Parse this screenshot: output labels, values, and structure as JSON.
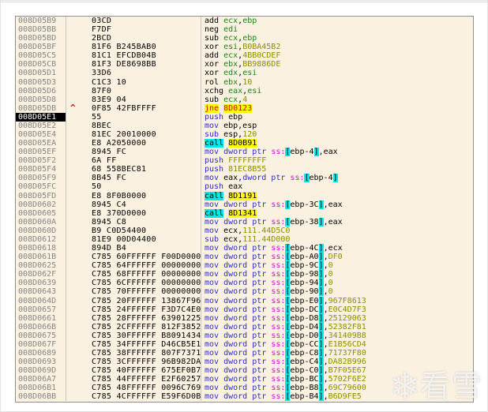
{
  "app": {
    "name": "debugger-disassembly-view"
  },
  "icons": {
    "jump_up": "^",
    "snowflake": "❄"
  },
  "watermark": {
    "text": "看雪"
  },
  "selected_address": "008D05E1",
  "colors": {
    "panel_background": "#FAF1E0",
    "address_gray": "#858585",
    "mnemonic_black": "#000000",
    "mnemonic_blue": "#2E2EC8",
    "register_green": "#178517",
    "number_olive": "#8D8D00",
    "segment_magenta": "#E400E4",
    "bracket_highlight": "#00E8E8",
    "call_highlight_bg": "#00E8E8",
    "target_highlight_bg": "#FFFF00",
    "jcc_red": "#CE0A0A",
    "selected_row_bg": "#000000",
    "selected_row_fg": "#FFFFFF"
  },
  "rows": [
    {
      "addr": "008D05B9",
      "bytes": "03CD",
      "arrow": false,
      "selected": false,
      "tokens": [
        [
          "add ",
          "mn"
        ],
        [
          "ecx",
          "rg"
        ],
        [
          ",",
          "pl"
        ],
        [
          "ebp",
          "rg"
        ]
      ]
    },
    {
      "addr": "008D05BB",
      "bytes": "F7DF",
      "arrow": false,
      "selected": false,
      "tokens": [
        [
          "neg ",
          "mn"
        ],
        [
          "edi",
          "rg"
        ]
      ]
    },
    {
      "addr": "008D05BD",
      "bytes": "2BCD",
      "arrow": false,
      "selected": false,
      "tokens": [
        [
          "sub ",
          "mn"
        ],
        [
          "ecx",
          "rg"
        ],
        [
          ",",
          "pl"
        ],
        [
          "ebp",
          "rg"
        ]
      ]
    },
    {
      "addr": "008D05BF",
      "bytes": "81F6 B245BAB0",
      "arrow": false,
      "selected": false,
      "tokens": [
        [
          "xor ",
          "mn"
        ],
        [
          "esi",
          "rg"
        ],
        [
          ",",
          "pl"
        ],
        [
          "B0BA45B2",
          "nu"
        ]
      ]
    },
    {
      "addr": "008D05C5",
      "bytes": "81C1 EFCDB04B",
      "arrow": false,
      "selected": false,
      "tokens": [
        [
          "add ",
          "mn"
        ],
        [
          "ecx",
          "rg"
        ],
        [
          ",",
          "pl"
        ],
        [
          "4BB0CDEF",
          "nu"
        ]
      ]
    },
    {
      "addr": "008D05CB",
      "bytes": "81F3 DE8698BB",
      "arrow": false,
      "selected": false,
      "tokens": [
        [
          "xor ",
          "mn"
        ],
        [
          "ebx",
          "rg"
        ],
        [
          ",",
          "pl"
        ],
        [
          "BB9886DE",
          "nu"
        ]
      ]
    },
    {
      "addr": "008D05D1",
      "bytes": "33D6",
      "arrow": false,
      "selected": false,
      "tokens": [
        [
          "xor ",
          "mn"
        ],
        [
          "edx",
          "rg"
        ],
        [
          ",",
          "pl"
        ],
        [
          "esi",
          "rg"
        ]
      ]
    },
    {
      "addr": "008D05D3",
      "bytes": "C1C3 10",
      "arrow": false,
      "selected": false,
      "tokens": [
        [
          "rol ",
          "mn"
        ],
        [
          "ebx",
          "rg"
        ],
        [
          ",",
          "pl"
        ],
        [
          "10",
          "nu"
        ]
      ]
    },
    {
      "addr": "008D05D6",
      "bytes": "87F0",
      "arrow": false,
      "selected": false,
      "tokens": [
        [
          "xchg ",
          "mn"
        ],
        [
          "eax",
          "rg"
        ],
        [
          ",",
          "pl"
        ],
        [
          "esi",
          "rg"
        ]
      ]
    },
    {
      "addr": "008D05D8",
      "bytes": "83E9 04",
      "arrow": false,
      "selected": false,
      "tokens": [
        [
          "sub ",
          "mn"
        ],
        [
          "ecx",
          "rg"
        ],
        [
          ",",
          "pl"
        ],
        [
          "4",
          "nu"
        ]
      ]
    },
    {
      "addr": "008D05DB",
      "bytes": "0F85 42FBFFFF",
      "arrow": true,
      "selected": false,
      "tokens": [
        [
          "jne",
          "jy"
        ],
        [
          " ",
          "pl"
        ],
        [
          "8D0123",
          "jy"
        ]
      ]
    },
    {
      "addr": "008D05E1",
      "bytes": "55",
      "arrow": false,
      "selected": true,
      "tokens": [
        [
          "push ",
          "bl"
        ],
        [
          "ebp",
          "pl"
        ]
      ]
    },
    {
      "addr": "008D05E2",
      "bytes": "8BEC",
      "arrow": false,
      "selected": false,
      "tokens": [
        [
          "mov ",
          "bl"
        ],
        [
          "ebp,esp",
          "pl"
        ]
      ]
    },
    {
      "addr": "008D05E4",
      "bytes": "81EC 20010000",
      "arrow": false,
      "selected": false,
      "tokens": [
        [
          "sub ",
          "bl"
        ],
        [
          "esp,",
          "pl"
        ],
        [
          "120",
          "nu"
        ]
      ]
    },
    {
      "addr": "008D05EA",
      "bytes": "E8 A2050000",
      "arrow": false,
      "selected": false,
      "tokens": [
        [
          "call",
          "cy"
        ],
        [
          " ",
          "pl"
        ],
        [
          "8D0B91",
          "ty"
        ]
      ]
    },
    {
      "addr": "008D05EF",
      "bytes": "8945 FC",
      "arrow": false,
      "selected": false,
      "tokens": [
        [
          "mov ",
          "bl"
        ],
        [
          "dword ptr ",
          "bl"
        ],
        [
          "ss:",
          "sg"
        ],
        [
          "[",
          "bo"
        ],
        [
          "ebp-4",
          "pl"
        ],
        [
          "]",
          "bc"
        ],
        [
          ",eax",
          "pl"
        ]
      ]
    },
    {
      "addr": "008D05F2",
      "bytes": "6A FF",
      "arrow": false,
      "selected": false,
      "tokens": [
        [
          "push ",
          "bl"
        ],
        [
          "FFFFFFFF",
          "nu"
        ]
      ]
    },
    {
      "addr": "008D05F4",
      "bytes": "68 558BEC81",
      "arrow": false,
      "selected": false,
      "tokens": [
        [
          "push ",
          "bl"
        ],
        [
          "81EC8B55",
          "nu"
        ]
      ]
    },
    {
      "addr": "008D05F9",
      "bytes": "8B45 FC",
      "arrow": false,
      "selected": false,
      "tokens": [
        [
          "mov ",
          "bl"
        ],
        [
          "eax,",
          "pl"
        ],
        [
          "dword ptr ",
          "bl"
        ],
        [
          "ss:",
          "sg"
        ],
        [
          "[",
          "bo"
        ],
        [
          "ebp-4",
          "pl"
        ],
        [
          "]",
          "bc"
        ]
      ]
    },
    {
      "addr": "008D05FC",
      "bytes": "50",
      "arrow": false,
      "selected": false,
      "tokens": [
        [
          "push ",
          "bl"
        ],
        [
          "eax",
          "pl"
        ]
      ]
    },
    {
      "addr": "008D05FD",
      "bytes": "E8 8F0B0000",
      "arrow": false,
      "selected": false,
      "tokens": [
        [
          "call",
          "cy"
        ],
        [
          " ",
          "pl"
        ],
        [
          "8D1191",
          "ty"
        ]
      ]
    },
    {
      "addr": "008D0602",
      "bytes": "8945 C4",
      "arrow": false,
      "selected": false,
      "tokens": [
        [
          "mov ",
          "bl"
        ],
        [
          "dword ptr ",
          "bl"
        ],
        [
          "ss:",
          "sg"
        ],
        [
          "[",
          "bo"
        ],
        [
          "ebp-3C",
          "pl"
        ],
        [
          "]",
          "bc"
        ],
        [
          ",eax",
          "pl"
        ]
      ]
    },
    {
      "addr": "008D0605",
      "bytes": "E8 370D0000",
      "arrow": false,
      "selected": false,
      "tokens": [
        [
          "call",
          "cy"
        ],
        [
          " ",
          "pl"
        ],
        [
          "8D1341",
          "ty"
        ]
      ]
    },
    {
      "addr": "008D060A",
      "bytes": "8945 C8",
      "arrow": false,
      "selected": false,
      "tokens": [
        [
          "mov ",
          "bl"
        ],
        [
          "dword ptr ",
          "bl"
        ],
        [
          "ss:",
          "sg"
        ],
        [
          "[",
          "bo"
        ],
        [
          "ebp-38",
          "pl"
        ],
        [
          "]",
          "bc"
        ],
        [
          ",eax",
          "pl"
        ]
      ]
    },
    {
      "addr": "008D060D",
      "bytes": "B9 C0D54400",
      "arrow": false,
      "selected": false,
      "tokens": [
        [
          "mov ",
          "bl"
        ],
        [
          "ecx,",
          "pl"
        ],
        [
          "111.44D5C0",
          "nu"
        ]
      ]
    },
    {
      "addr": "008D0612",
      "bytes": "81E9 00D04400",
      "arrow": false,
      "selected": false,
      "tokens": [
        [
          "sub ",
          "bl"
        ],
        [
          "ecx,",
          "pl"
        ],
        [
          "111.44D000",
          "nu"
        ]
      ]
    },
    {
      "addr": "008D0618",
      "bytes": "894D B4",
      "arrow": false,
      "selected": false,
      "tokens": [
        [
          "mov ",
          "bl"
        ],
        [
          "dword ptr ",
          "bl"
        ],
        [
          "ss:",
          "sg"
        ],
        [
          "[",
          "bo"
        ],
        [
          "ebp-4C",
          "pl"
        ],
        [
          "]",
          "bc"
        ],
        [
          ",ecx",
          "pl"
        ]
      ]
    },
    {
      "addr": "008D061B",
      "bytes": "C785 60FFFFFF F00D0000",
      "arrow": false,
      "selected": false,
      "tokens": [
        [
          "mov ",
          "bl"
        ],
        [
          "dword ptr ",
          "bl"
        ],
        [
          "ss:",
          "sg"
        ],
        [
          "[",
          "bo"
        ],
        [
          "ebp-A0",
          "pl"
        ],
        [
          "]",
          "bc"
        ],
        [
          ",",
          "pl"
        ],
        [
          "DF0",
          "nu"
        ]
      ]
    },
    {
      "addr": "008D0625",
      "bytes": "C785 64FFFFFF 00000000",
      "arrow": false,
      "selected": false,
      "tokens": [
        [
          "mov ",
          "bl"
        ],
        [
          "dword ptr ",
          "bl"
        ],
        [
          "ss:",
          "sg"
        ],
        [
          "[",
          "bo"
        ],
        [
          "ebp-9C",
          "pl"
        ],
        [
          "]",
          "bc"
        ],
        [
          ",",
          "pl"
        ],
        [
          "0",
          "nu"
        ]
      ]
    },
    {
      "addr": "008D062F",
      "bytes": "C785 68FFFFFF 00000000",
      "arrow": false,
      "selected": false,
      "tokens": [
        [
          "mov ",
          "bl"
        ],
        [
          "dword ptr ",
          "bl"
        ],
        [
          "ss:",
          "sg"
        ],
        [
          "[",
          "bo"
        ],
        [
          "ebp-98",
          "pl"
        ],
        [
          "]",
          "bc"
        ],
        [
          ",",
          "pl"
        ],
        [
          "0",
          "nu"
        ]
      ]
    },
    {
      "addr": "008D0639",
      "bytes": "C785 6CFFFFFF 00000000",
      "arrow": false,
      "selected": false,
      "tokens": [
        [
          "mov ",
          "bl"
        ],
        [
          "dword ptr ",
          "bl"
        ],
        [
          "ss:",
          "sg"
        ],
        [
          "[",
          "bo"
        ],
        [
          "ebp-94",
          "pl"
        ],
        [
          "]",
          "bc"
        ],
        [
          ",",
          "pl"
        ],
        [
          "0",
          "nu"
        ]
      ]
    },
    {
      "addr": "008D0643",
      "bytes": "C785 70FFFFFF 00000000",
      "arrow": false,
      "selected": false,
      "tokens": [
        [
          "mov ",
          "bl"
        ],
        [
          "dword ptr ",
          "bl"
        ],
        [
          "ss:",
          "sg"
        ],
        [
          "[",
          "bo"
        ],
        [
          "ebp-90",
          "pl"
        ],
        [
          "]",
          "bc"
        ],
        [
          ",",
          "pl"
        ],
        [
          "0",
          "nu"
        ]
      ]
    },
    {
      "addr": "008D064D",
      "bytes": "C785 20FFFFFF 13867F96",
      "arrow": false,
      "selected": false,
      "tokens": [
        [
          "mov ",
          "bl"
        ],
        [
          "dword ptr ",
          "bl"
        ],
        [
          "ss:",
          "sg"
        ],
        [
          "[",
          "bo"
        ],
        [
          "ebp-E0",
          "pl"
        ],
        [
          "]",
          "bc"
        ],
        [
          ",",
          "pl"
        ],
        [
          "967F8613",
          "nu"
        ]
      ]
    },
    {
      "addr": "008D0657",
      "bytes": "C785 24FFFFFF F3D7C4E0",
      "arrow": false,
      "selected": false,
      "tokens": [
        [
          "mov ",
          "bl"
        ],
        [
          "dword ptr ",
          "bl"
        ],
        [
          "ss:",
          "sg"
        ],
        [
          "[",
          "bo"
        ],
        [
          "ebp-DC",
          "pl"
        ],
        [
          "]",
          "bc"
        ],
        [
          ",",
          "pl"
        ],
        [
          "E0C4D7F3",
          "nu"
        ]
      ]
    },
    {
      "addr": "008D0661",
      "bytes": "C785 28FFFFFF 63901225",
      "arrow": false,
      "selected": false,
      "tokens": [
        [
          "mov ",
          "bl"
        ],
        [
          "dword ptr ",
          "bl"
        ],
        [
          "ss:",
          "sg"
        ],
        [
          "[",
          "bo"
        ],
        [
          "ebp-D8",
          "pl"
        ],
        [
          "]",
          "bc"
        ],
        [
          ",",
          "pl"
        ],
        [
          "25129063",
          "nu"
        ]
      ]
    },
    {
      "addr": "008D066B",
      "bytes": "C785 2CFFFFFF 812F3852",
      "arrow": false,
      "selected": false,
      "tokens": [
        [
          "mov ",
          "bl"
        ],
        [
          "dword ptr ",
          "bl"
        ],
        [
          "ss:",
          "sg"
        ],
        [
          "[",
          "bo"
        ],
        [
          "ebp-D4",
          "pl"
        ],
        [
          "]",
          "bc"
        ],
        [
          ",",
          "pl"
        ],
        [
          "52382F81",
          "nu"
        ]
      ]
    },
    {
      "addr": "008D0675",
      "bytes": "C785 30FFFFFF B8091434",
      "arrow": false,
      "selected": false,
      "tokens": [
        [
          "mov ",
          "bl"
        ],
        [
          "dword ptr ",
          "bl"
        ],
        [
          "ss:",
          "sg"
        ],
        [
          "[",
          "bo"
        ],
        [
          "ebp-D0",
          "pl"
        ],
        [
          "]",
          "bc"
        ],
        [
          ",",
          "pl"
        ],
        [
          "341409B8",
          "nu"
        ]
      ]
    },
    {
      "addr": "008D067F",
      "bytes": "C785 34FFFFFF D46CB5E1",
      "arrow": false,
      "selected": false,
      "tokens": [
        [
          "mov ",
          "bl"
        ],
        [
          "dword ptr ",
          "bl"
        ],
        [
          "ss:",
          "sg"
        ],
        [
          "[",
          "bo"
        ],
        [
          "ebp-CC",
          "pl"
        ],
        [
          "]",
          "bc"
        ],
        [
          ",",
          "pl"
        ],
        [
          "E1B56CD4",
          "nu"
        ]
      ]
    },
    {
      "addr": "008D0689",
      "bytes": "C785 38FFFFFF 807F7371",
      "arrow": false,
      "selected": false,
      "tokens": [
        [
          "mov ",
          "bl"
        ],
        [
          "dword ptr ",
          "bl"
        ],
        [
          "ss:",
          "sg"
        ],
        [
          "[",
          "bo"
        ],
        [
          "ebp-C8",
          "pl"
        ],
        [
          "]",
          "bc"
        ],
        [
          ",",
          "pl"
        ],
        [
          "71737F80",
          "nu"
        ]
      ]
    },
    {
      "addr": "008D0693",
      "bytes": "C785 3CFFFFFF 96B982DA",
      "arrow": false,
      "selected": false,
      "tokens": [
        [
          "mov ",
          "bl"
        ],
        [
          "dword ptr ",
          "bl"
        ],
        [
          "ss:",
          "sg"
        ],
        [
          "[",
          "bo"
        ],
        [
          "ebp-C4",
          "pl"
        ],
        [
          "]",
          "bc"
        ],
        [
          ",",
          "pl"
        ],
        [
          "DA82B996",
          "nu"
        ]
      ]
    },
    {
      "addr": "008D069D",
      "bytes": "C785 40FFFFFF 675EF0B7",
      "arrow": false,
      "selected": false,
      "tokens": [
        [
          "mov ",
          "bl"
        ],
        [
          "dword ptr ",
          "bl"
        ],
        [
          "ss:",
          "sg"
        ],
        [
          "[",
          "bo"
        ],
        [
          "ebp-C0",
          "pl"
        ],
        [
          "]",
          "bc"
        ],
        [
          ",",
          "pl"
        ],
        [
          "B7F05E67",
          "nu"
        ]
      ]
    },
    {
      "addr": "008D06A7",
      "bytes": "C785 44FFFFFF E2F60257",
      "arrow": false,
      "selected": false,
      "tokens": [
        [
          "mov ",
          "bl"
        ],
        [
          "dword ptr ",
          "bl"
        ],
        [
          "ss:",
          "sg"
        ],
        [
          "[",
          "bo"
        ],
        [
          "ebp-BC",
          "pl"
        ],
        [
          "]",
          "bc"
        ],
        [
          ",",
          "pl"
        ],
        [
          "5702F6E2",
          "nu"
        ]
      ]
    },
    {
      "addr": "008D06B1",
      "bytes": "C785 48FFFFFF 0096C769",
      "arrow": false,
      "selected": false,
      "tokens": [
        [
          "mov ",
          "bl"
        ],
        [
          "dword ptr ",
          "bl"
        ],
        [
          "ss:",
          "sg"
        ],
        [
          "[",
          "bo"
        ],
        [
          "ebp-B8",
          "pl"
        ],
        [
          "]",
          "bc"
        ],
        [
          ",",
          "pl"
        ],
        [
          "69C79600",
          "nu"
        ]
      ]
    },
    {
      "addr": "008D06BB",
      "bytes": "C785 4CFFFFFF E59F6D0B",
      "arrow": false,
      "selected": false,
      "tokens": [
        [
          "mov ",
          "bl"
        ],
        [
          "dword ptr ",
          "bl"
        ],
        [
          "ss:",
          "sg"
        ],
        [
          "[",
          "bo"
        ],
        [
          "ebp-B4",
          "pl"
        ],
        [
          "]",
          "bc"
        ],
        [
          ",",
          "pl"
        ],
        [
          "B6D9FE5",
          "nu"
        ]
      ]
    }
  ]
}
